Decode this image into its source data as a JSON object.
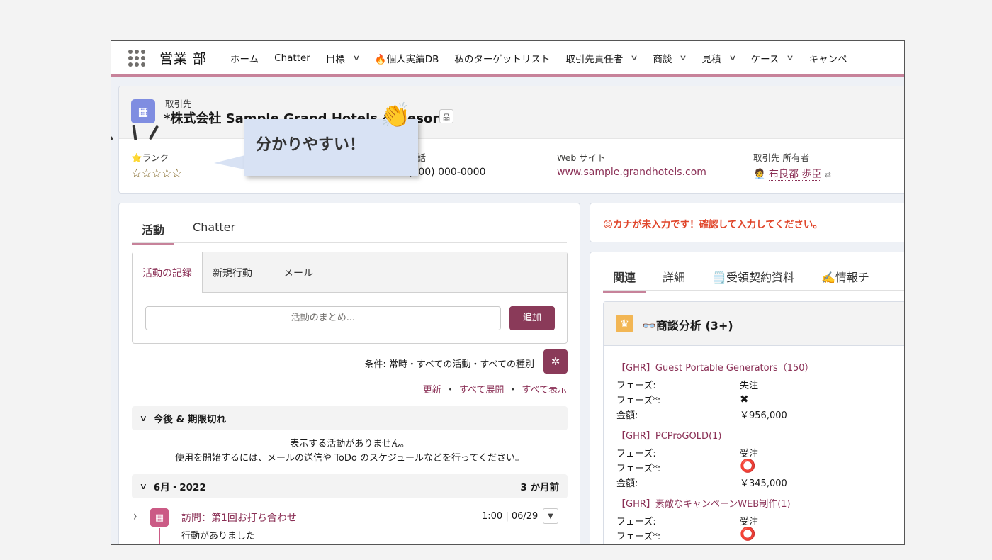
{
  "nav": {
    "app_name": "営業 部",
    "items": [
      {
        "label": "ホーム",
        "dropdown": false
      },
      {
        "label": "Chatter",
        "dropdown": false
      },
      {
        "label": "目標",
        "dropdown": true
      },
      {
        "label": "🔥個人実績DB",
        "dropdown": false
      },
      {
        "label": "私のターゲットリスト",
        "dropdown": false
      },
      {
        "label": "取引先責任者",
        "dropdown": true
      },
      {
        "label": "商談",
        "dropdown": true
      },
      {
        "label": "見積",
        "dropdown": true
      },
      {
        "label": "ケース",
        "dropdown": true
      },
      {
        "label": "キャンペ",
        "dropdown": false
      }
    ]
  },
  "record": {
    "object_type": "取引先",
    "name": "*株式会社 Sample Grand Hotels & Resorts",
    "fields": {
      "rank_label": "⭐ランク",
      "rank_value": "☆☆☆☆☆",
      "phone_label": "電話",
      "phone_value": "(000) 000-0000",
      "website_label": "Web サイト",
      "website_value": "www.sample.grandhotels.com",
      "owner_label": "取引先 所有者",
      "owner_value": "布良都 歩臣"
    }
  },
  "callout": {
    "text": "分かりやすい！",
    "emoji": "👏"
  },
  "activity": {
    "tabs": [
      "活動",
      "Chatter"
    ],
    "composer_tabs": [
      "活動の記録",
      "新規行動",
      "メール"
    ],
    "summary_placeholder": "活動のまとめ...",
    "add_label": "追加",
    "filter_text": "条件: 常時・すべての活動・すべての種別",
    "links": [
      "更新",
      "すべて展開",
      "すべて表示"
    ],
    "upcoming_section": "今後 & 期限切れ",
    "empty_line1": "表示する活動がありません。",
    "empty_line2": "使用を開始するには、メールの送信や ToDo のスケジュールなどを行ってください。",
    "month_section": "6月・2022",
    "month_ago": "3 か月前",
    "item": {
      "title": "訪問：第1回お打ち合わせ",
      "time": "1:00 | 06/29",
      "desc": "行動がありました"
    }
  },
  "alert": {
    "text": "😡カナが未入力です！確認して入力してください。"
  },
  "related": {
    "tabs": [
      "関連",
      "詳細",
      "🗒️受領契約資料",
      "✍️情報チ"
    ],
    "opp_title": "👓商談分析 (3+)",
    "opportunities": [
      {
        "name": "【GHR】Guest Portable Generators（150）",
        "phase_label": "フェーズ:",
        "phase": "失注",
        "phase2_label": "フェーズ*:",
        "phase2": "✖",
        "amount_label": "金額:",
        "amount": "￥956,000"
      },
      {
        "name": "【GHR】PCProGOLD(1)",
        "phase_label": "フェーズ:",
        "phase": "受注",
        "phase2_label": "フェーズ*:",
        "phase2": "⭕",
        "amount_label": "金額:",
        "amount": "￥345,000"
      },
      {
        "name": "【GHR】素敵なキャンペーンWEB制作(1)",
        "phase_label": "フェーズ:",
        "phase": "受注",
        "phase2_label": "フェーズ*:",
        "phase2": "⭕",
        "amount_label": "",
        "amount": ""
      }
    ]
  },
  "colors": {
    "accent": "#8a3a59",
    "link": "#8a2f55",
    "nav_border": "#c7829a",
    "alert": "#e0462b"
  }
}
